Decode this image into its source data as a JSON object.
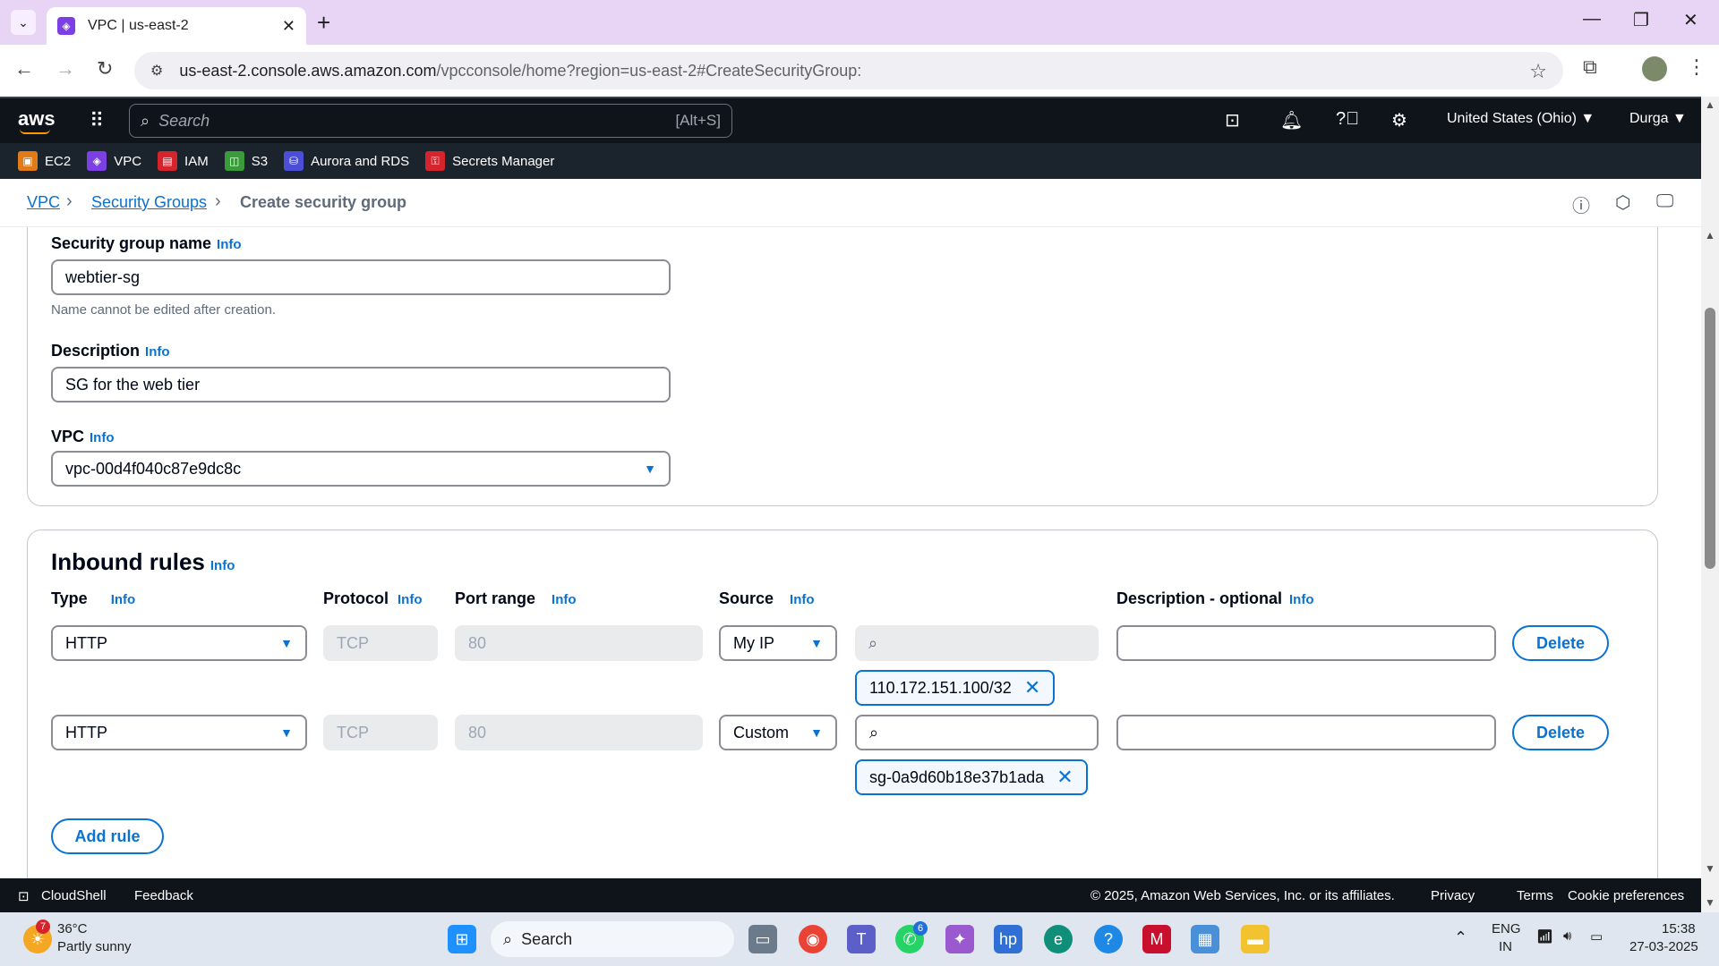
{
  "browser": {
    "tab_title": "VPC | us-east-2",
    "url_host": "us-east-2.console.aws.amazon.com",
    "url_path": "/vpcconsole/home?region=us-east-2#CreateSecurityGroup:"
  },
  "awsnav": {
    "logo": "aws",
    "search_placeholder": "Search",
    "search_shortcut": "[Alt+S]",
    "region": "United States (Ohio) ▼",
    "user": "Durga ▼",
    "favorites": [
      "EC2",
      "VPC",
      "IAM",
      "S3",
      "Aurora and RDS",
      "Secrets Manager"
    ]
  },
  "breadcrumb": {
    "vpc": "VPC",
    "security_groups": "Security Groups",
    "current": "Create security group"
  },
  "basic": {
    "name_label": "Security group name",
    "info": "Info",
    "name_value": "webtier-sg",
    "name_hint": "Name cannot be edited after creation.",
    "desc_label": "Description",
    "desc_value": "SG for the web tier",
    "vpc_label": "VPC",
    "vpc_value": "vpc-00d4f040c87e9dc8c"
  },
  "inbound": {
    "title": "Inbound rules",
    "columns": {
      "type": "Type",
      "protocol": "Protocol",
      "port_range": "Port range",
      "source": "Source",
      "description": "Description - optional"
    },
    "rules": [
      {
        "type": "HTTP",
        "protocol": "TCP",
        "port": "80",
        "source": "My IP",
        "token": "110.172.151.100/32",
        "delete": "Delete"
      },
      {
        "type": "HTTP",
        "protocol": "TCP",
        "port": "80",
        "source": "Custom",
        "token": "sg-0a9d60b18e37b1ada",
        "delete": "Delete"
      }
    ],
    "add_rule": "Add rule"
  },
  "footer": {
    "cloudshell": "CloudShell",
    "feedback": "Feedback",
    "copyright": "© 2025, Amazon Web Services, Inc. or its affiliates.",
    "privacy": "Privacy",
    "terms": "Terms",
    "cookies": "Cookie preferences"
  },
  "taskbar": {
    "weather_temp": "36°C",
    "weather_desc": "Partly sunny",
    "weather_badge": "7",
    "search": "Search",
    "whatsapp_badge": "6",
    "lang1": "ENG",
    "lang2": "IN",
    "time": "15:38",
    "date": "27-03-2025"
  }
}
